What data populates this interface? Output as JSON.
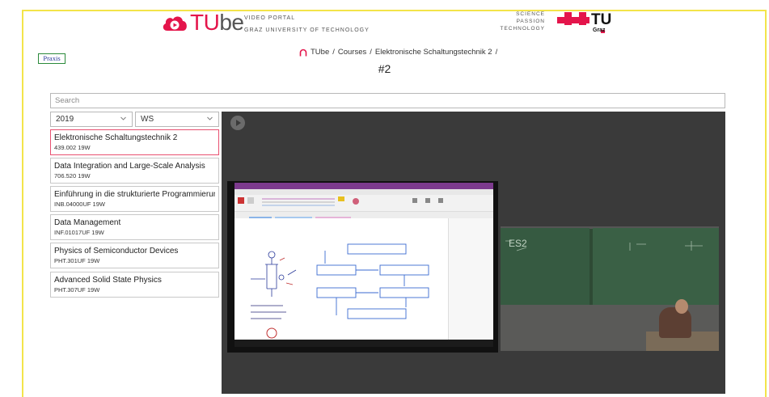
{
  "header": {
    "brand_tu": "TU",
    "brand_be": "be",
    "brand_subtitle_line1": "VIDEO PORTAL",
    "brand_subtitle_line2": "GRAZ UNIVERSITY OF TECHNOLOGY",
    "tug_line1": "SCIENCE",
    "tug_line2": "PASSION",
    "tug_line3": "TECHNOLOGY",
    "tug_logo_text": "TU",
    "tug_logo_sub": "Graz",
    "accent_color": "#e4154b",
    "frame_color": "#f3e44a"
  },
  "breadcrumb": {
    "items": [
      "TUbe",
      "Courses",
      "Elektronische Schaltungstechnik 2"
    ],
    "separator": "/",
    "trailing": "/"
  },
  "page_title": "#2",
  "search": {
    "placeholder": "Search",
    "value": ""
  },
  "filters": {
    "year": "2019",
    "semester": "WS"
  },
  "courses": [
    {
      "name": "Elektronische Schaltungstechnik 2",
      "code": "439.002 19W",
      "active": true
    },
    {
      "name": "Data Integration and Large-Scale Analysis",
      "code": "706.520 19W",
      "active": false
    },
    {
      "name": "Einführung in die strukturierte Programmierung",
      "code": "INB.04000UF 19W",
      "active": false
    },
    {
      "name": "Data Management",
      "code": "INF.01017UF 19W",
      "active": false
    },
    {
      "name": "Physics of Semiconductor Devices",
      "code": "PHT.301UF 19W",
      "active": false
    },
    {
      "name": "Advanced Solid State Physics",
      "code": "PHT.307UF 19W",
      "active": false
    }
  ],
  "player": {
    "slide_heading": "Praxis",
    "chalk_text": "ES2"
  }
}
